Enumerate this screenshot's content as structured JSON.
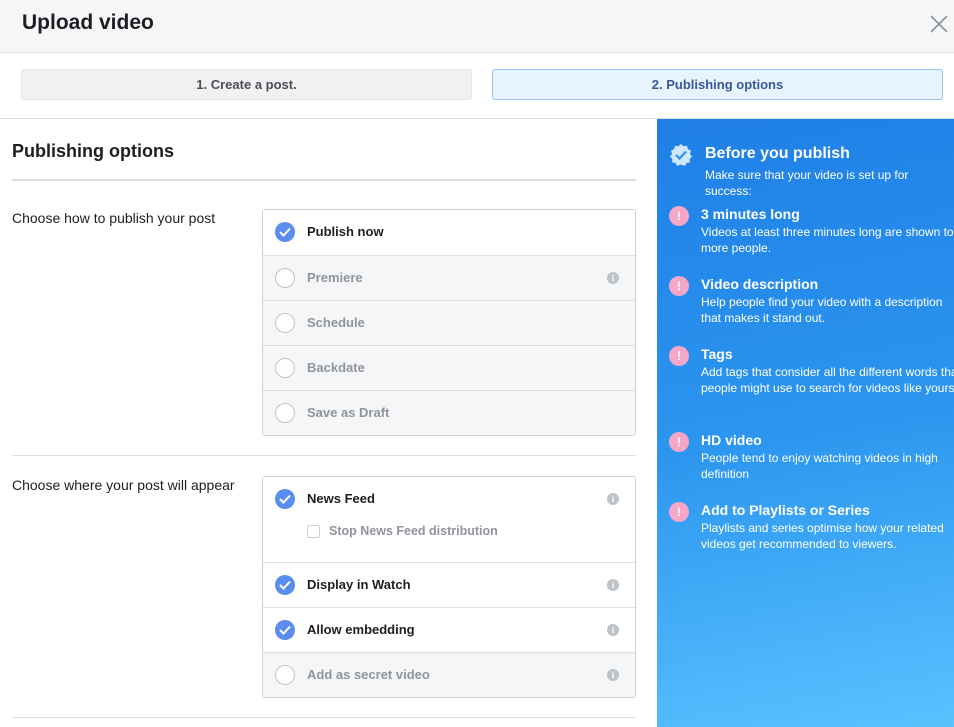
{
  "header": {
    "title": "Upload video"
  },
  "steps": [
    {
      "label": "1. Create a post."
    },
    {
      "label": "2. Publishing options"
    }
  ],
  "main": {
    "heading": "Publishing options",
    "publish_section": {
      "label": "Choose how to publish your post",
      "options": [
        {
          "label": "Publish now",
          "checked": true
        },
        {
          "label": "Premiere",
          "checked": false,
          "info": true
        },
        {
          "label": "Schedule",
          "checked": false
        },
        {
          "label": "Backdate",
          "checked": false
        },
        {
          "label": "Save as Draft",
          "checked": false
        }
      ]
    },
    "appear_section": {
      "label": "Choose where your post will appear",
      "options": [
        {
          "label": "News Feed",
          "checked": true,
          "info": true,
          "sub": {
            "label": "Stop News Feed distribution",
            "checked": false
          }
        },
        {
          "label": "Display in Watch",
          "checked": true,
          "info": true
        },
        {
          "label": "Allow embedding",
          "checked": true,
          "info": true
        },
        {
          "label": "Add as secret video",
          "checked": false,
          "info": true
        }
      ]
    }
  },
  "sidebar": {
    "title": "Before you publish",
    "subtitle": "Make sure that your video is set up for success:",
    "tips": [
      {
        "title": "3 minutes long",
        "desc": "Videos at least three minutes long are shown to more people."
      },
      {
        "title": "Video description",
        "desc": "Help people find your video with a description that makes it stand out."
      },
      {
        "title": "Tags",
        "desc": "Add tags that consider all the different words that people might use to search for videos like yours."
      },
      {
        "title": "HD video",
        "desc": "People tend to enjoy watching videos in high definition"
      },
      {
        "title": "Add to Playlists or Series",
        "desc": "Playlists and series optimise how your related videos get recommended to viewers."
      }
    ]
  },
  "colors": {
    "accent": "#5b8def",
    "sidebar": "#2b95ef",
    "tip_icon": "#f6a6c7"
  },
  "icons": {
    "close": "close-icon",
    "check": "check-icon",
    "info": "info-icon",
    "verified": "verified-badge-icon",
    "alert": "exclamation-icon"
  }
}
